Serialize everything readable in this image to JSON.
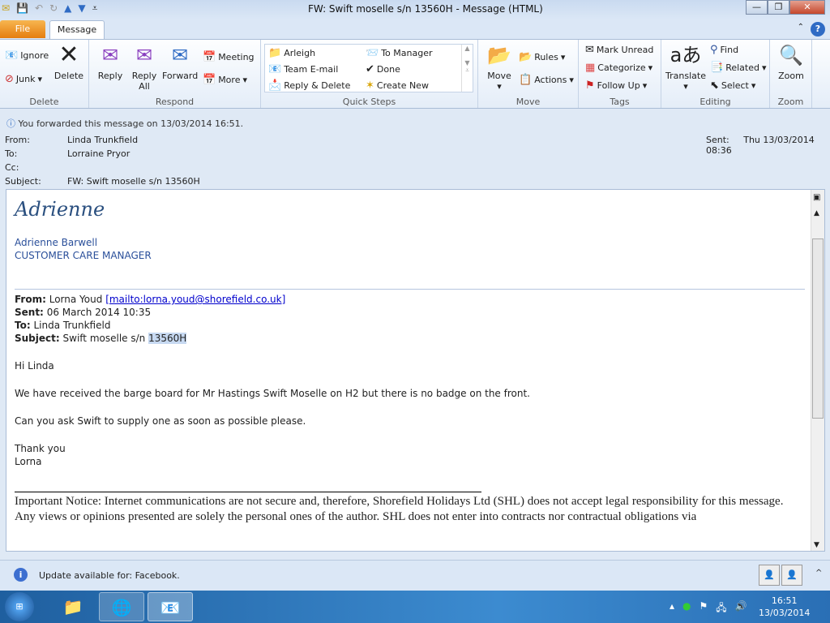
{
  "window": {
    "title": "FW: Swift moselle s/n 13560H  -  Message (HTML)"
  },
  "tabs": {
    "file": "File",
    "message": "Message"
  },
  "ribbon": {
    "delete": {
      "label": "Delete",
      "ignore": "Ignore",
      "junk": "Junk",
      "delete": "Delete"
    },
    "respond": {
      "label": "Respond",
      "reply": "Reply",
      "reply_all_1": "Reply",
      "reply_all_2": "All",
      "forward": "Forward",
      "meeting": "Meeting",
      "more": "More"
    },
    "quick_steps": {
      "label": "Quick Steps",
      "items": [
        "Arleigh",
        "To Manager",
        "Team E-mail",
        "Done",
        "Reply & Delete",
        "Create New"
      ]
    },
    "move": {
      "label": "Move",
      "move": "Move",
      "rules": "Rules",
      "actions": "Actions"
    },
    "tags": {
      "label": "Tags",
      "mark_unread": "Mark Unread",
      "categorize": "Categorize",
      "follow_up": "Follow Up"
    },
    "editing": {
      "label": "Editing",
      "translate": "Translate",
      "find": "Find",
      "related": "Related",
      "select": "Select"
    },
    "zoom": {
      "label": "Zoom",
      "zoom": "Zoom"
    }
  },
  "info": "You forwarded this message on 13/03/2014 16:51.",
  "header": {
    "from_label": "From:",
    "from": "Linda Trunkfield",
    "to_label": "To:",
    "to": "Lorraine Pryor",
    "cc_label": "Cc:",
    "subject_label": "Subject:",
    "subject": "FW: Swift moselle s/n 13560H",
    "sent_label": "Sent:",
    "sent": "Thu 13/03/2014 08:36"
  },
  "body": {
    "signature_script": "Adrienne",
    "sig_name": "Adrienne Barwell",
    "sig_title": "CUSTOMER CARE MANAGER",
    "fwd_from_label": "From:",
    "fwd_from": "Lorna Youd",
    "fwd_mailto": "[mailto:lorna.youd@shorefield.co.uk]",
    "fwd_sent_label": "Sent:",
    "fwd_sent": "06 March 2014 10:35",
    "fwd_to_label": "To:",
    "fwd_to": "Linda Trunkfield",
    "fwd_subject_label": "Subject:",
    "fwd_subject": "Swift moselle s/n",
    "fwd_subject_sel": "13560H",
    "greeting": "Hi Linda",
    "p1": "We have received the barge board for Mr Hastings Swift Moselle on H2 but there is no badge on the front.",
    "p2": "Can you ask Swift to supply one as soon as possible please.",
    "thanks": "Thank you",
    "name": "Lorna",
    "notice": "Important Notice: Internet communications are not secure and, therefore, Shorefield Holidays Ltd (SHL) does not accept legal responsibility for this message. Any views or opinions presented are solely the personal ones of the author. SHL does not enter into contracts nor contractual obligations via"
  },
  "status": {
    "update": "Update available for: Facebook."
  },
  "taskbar": {
    "time": "16:51",
    "date": "13/03/2014"
  }
}
